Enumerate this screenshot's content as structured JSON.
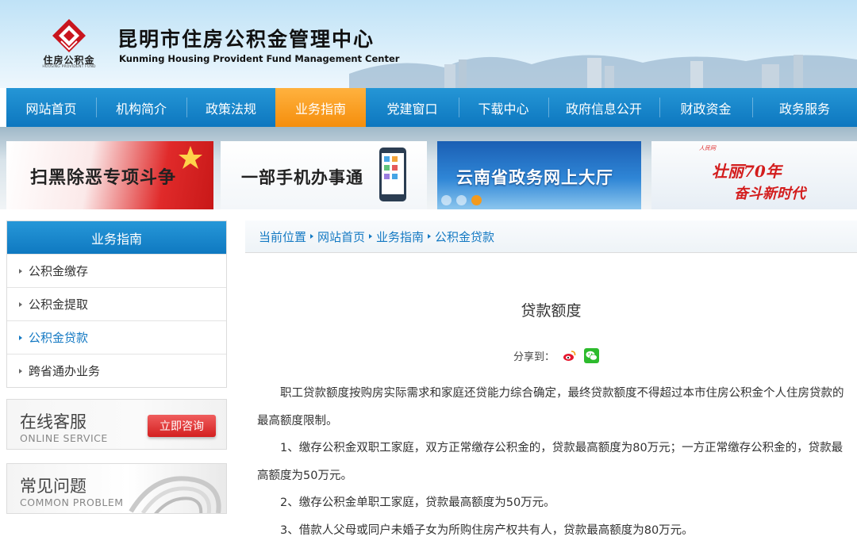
{
  "header": {
    "logo_cn": "住房公积金",
    "logo_en": "HOUSING PROVIDENT FUND",
    "title": "昆明市住房公积金管理中心",
    "subtitle": "Kunming Housing Provident Fund Management Center"
  },
  "nav": {
    "items": [
      {
        "label": "网站首页"
      },
      {
        "label": "机构简介"
      },
      {
        "label": "政策法规"
      },
      {
        "label": "业务指南",
        "active": true
      },
      {
        "label": "党建窗口"
      },
      {
        "label": "下载中心"
      },
      {
        "label": "政府信息公开"
      },
      {
        "label": "财政资金"
      },
      {
        "label": "政务服务"
      }
    ]
  },
  "banners": [
    {
      "text": "扫黑除恶专项斗争"
    },
    {
      "text": "一部手机办事通"
    },
    {
      "text": "云南省政务网上大厅"
    },
    {
      "text": "壮丽70年",
      "text2": "奋斗新时代"
    }
  ],
  "sidebar": {
    "heading": "业务指南",
    "items": [
      {
        "label": "公积金缴存"
      },
      {
        "label": "公积金提取"
      },
      {
        "label": "公积金贷款",
        "active": true
      },
      {
        "label": "跨省通办业务"
      }
    ],
    "online": {
      "title": "在线客服",
      "subtitle": "ONLINE SERVICE",
      "button": "立即咨询"
    },
    "faq": {
      "title": "常见问题",
      "subtitle": "COMMON PROBLEM"
    }
  },
  "breadcrumb": [
    "当前位置",
    "网站首页",
    "业务指南",
    "公积金贷款"
  ],
  "article": {
    "title": "贷款额度",
    "share_label": "分享到：",
    "paragraphs": [
      "职工贷款额度按购房实际需求和家庭还贷能力综合确定，最终贷款额度不得超过本市住房公积金个人住房贷款的最高额度限制。",
      "1、缴存公积金双职工家庭，双方正常缴存公积金的，贷款最高额度为80万元；一方正常缴存公积金的，贷款最高额度为50万元。",
      "2、缴存公积金单职工家庭，贷款最高额度为50万元。",
      "3、借款人父母或同户未婚子女为所购住房产权共有人，贷款最高额度为80万元。"
    ]
  },
  "colors": {
    "nav_blue": "#0d77bf",
    "nav_active": "#f58e0c",
    "link_blue": "#1479c3",
    "consult_red": "#d42020"
  }
}
